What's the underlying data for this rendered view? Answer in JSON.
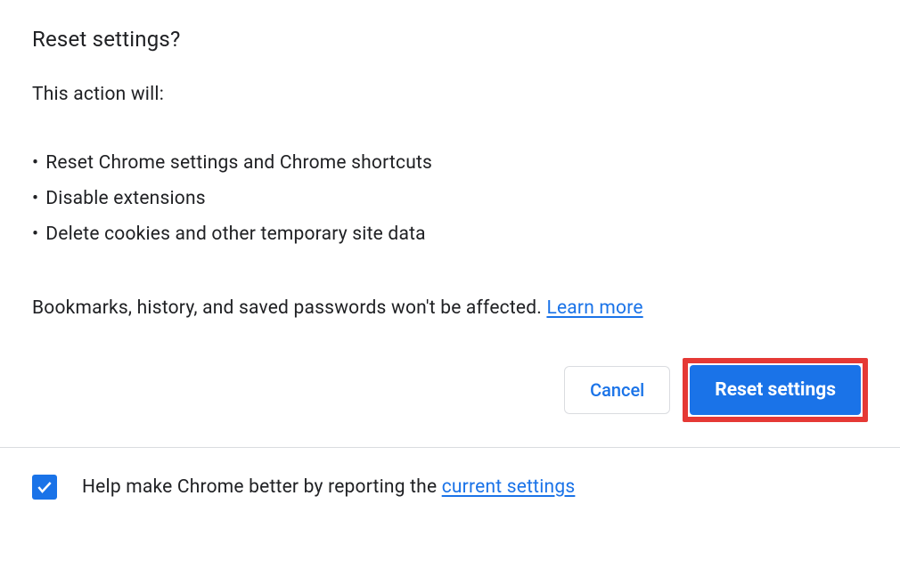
{
  "dialog": {
    "title": "Reset settings?",
    "subtitle": "This action will:",
    "bullets": {
      "0": "Reset Chrome settings and Chrome shortcuts",
      "1": "Disable extensions",
      "2": "Delete cookies and other temporary site data"
    },
    "footnote_text": "Bookmarks, history, and saved passwords won't be affected. ",
    "learn_more": "Learn more",
    "buttons": {
      "cancel": "Cancel",
      "reset": "Reset settings"
    }
  },
  "footer": {
    "checked": true,
    "text_prefix": "Help make Chrome better by reporting the ",
    "link": "current settings"
  }
}
